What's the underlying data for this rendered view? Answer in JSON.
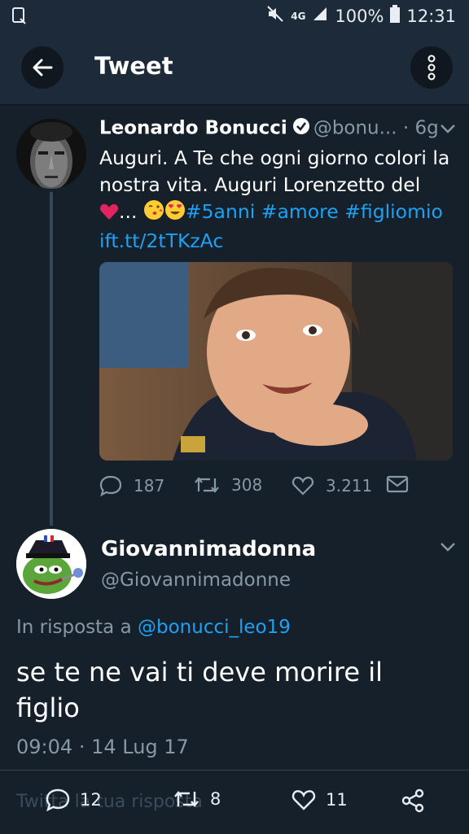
{
  "status_bar": {
    "network": "4G",
    "battery": "100%",
    "time": "12:31"
  },
  "app_bar": {
    "title": "Tweet"
  },
  "tweet1": {
    "name": "Leonardo Bonucci",
    "handle": "@bonu...",
    "separator": "·",
    "age": "6g",
    "text_line1": "Auguri. A Te che ogni giorno colori la",
    "text_line2": "nostra vita. Auguri Lorenzetto del",
    "ellipsis": "...",
    "hashtags": [
      "#5anni",
      "#amore",
      "#figliomio"
    ],
    "link": "ift.tt/2tTKzAc",
    "replies": "187",
    "retweets": "308",
    "likes": "3.211"
  },
  "tweet2": {
    "name": "Giovannimadonna",
    "handle": "@Giovannimadonne",
    "replying_label": "In risposta a",
    "replying_to": "@bonucci_leo19",
    "text": "se te ne vai ti deve morire il figlio",
    "time": "09:04",
    "separator": "·",
    "date": "14 Lug 17"
  },
  "bottom_bar": {
    "reply_placeholder": "Twitta la tua risposta",
    "replies": "12",
    "retweets": "8",
    "likes": "11"
  },
  "colors": {
    "background": "#15202b",
    "bar": "#1c2a39",
    "accent": "#1da1f2",
    "muted": "#8899a6",
    "heart": "#e0245e"
  }
}
